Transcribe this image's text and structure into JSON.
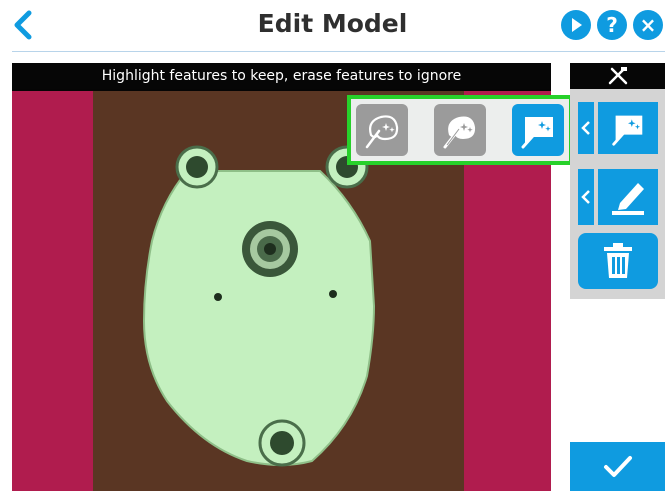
{
  "header": {
    "title": "Edit Model",
    "back_icon": "chevron-left-icon",
    "play_icon": "play-icon",
    "help_label": "?",
    "close_label": "×"
  },
  "canvas": {
    "instruction": "Highlight features to keep, erase features to ignore"
  },
  "tools_popup": {
    "items": [
      "brush-outline-icon",
      "brush-wand-icon",
      "brush-highlight-icon"
    ],
    "active_index": 2
  },
  "side_panel": {
    "header_icon": "tools-icon",
    "buttons": [
      "brush-highlight-icon",
      "marker-pen-icon",
      "trash-icon"
    ]
  },
  "confirm": {
    "icon": "checkmark-icon"
  },
  "colors": {
    "accent": "#0f9be0",
    "popup_border": "#27d12a",
    "background_magenta": "#b01c4e",
    "background_brown": "#5a3623",
    "part_green": "#c4f0bf"
  }
}
